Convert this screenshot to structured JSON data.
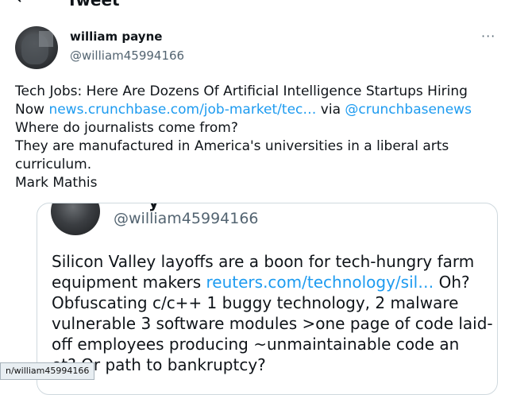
{
  "header": {
    "back_glyph": "←",
    "title": "Tweet"
  },
  "author": {
    "name": "william payne",
    "handle": "@william45994166",
    "more": "···"
  },
  "tweet": {
    "line1": "Tech Jobs: Here Are Dozens Of Artificial Intelligence Startups Hiring",
    "line2_pre": "Now ",
    "link1": "news.crunchbase.com/job-market/tec…",
    "line2_mid": " via ",
    "mention": "@crunchbasenews",
    "line3": "Where do journalists come from?",
    "line4": "They are manufactured in America's universities in a liberal arts",
    "line5": "curriculum.",
    "line6": "Mark Mathis"
  },
  "quote": {
    "name_fragment": "y",
    "handle": "@william45994166",
    "line1": "Silicon Valley layoffs are a boon for tech-hungry farm",
    "line2_pre": "equipment makers ",
    "link": "reuters.com/technology/sil…",
    "line2_post": " Oh?",
    "line3": "Obfuscating c/c++ 1 buggy technology, 2 malware",
    "line4": "vulnerable 3 software modules >one page of code laid-",
    "line5": "off employees producing ~unmaintainable code an",
    "line6": "et? Or path to  bankruptcy?"
  },
  "status_tooltip": "n/william45994166",
  "colors": {
    "link": "#1d9bf0",
    "secondary": "#536471",
    "border": "#cfd9de"
  }
}
